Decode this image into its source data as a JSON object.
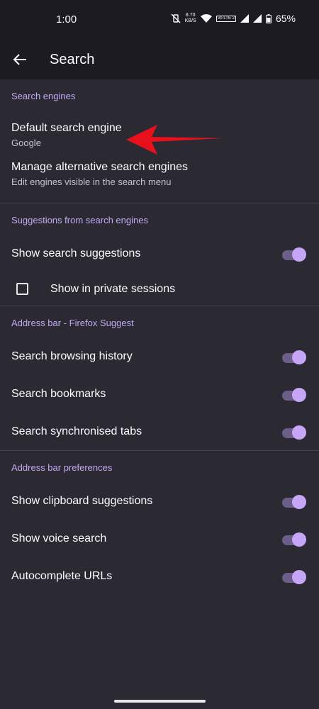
{
  "status_bar": {
    "time": "1:00",
    "net_speed_value": "8.70",
    "net_speed_unit": "KB/S",
    "volte_label": "Vo LTE 2",
    "battery_percent": "65%"
  },
  "app_bar": {
    "title": "Search"
  },
  "sections": {
    "search_engines": {
      "header": "Search engines",
      "default_engine": {
        "title": "Default search engine",
        "summary": "Google"
      },
      "manage_engines": {
        "title": "Manage alternative search engines",
        "summary": "Edit engines visible in the search menu"
      }
    },
    "suggestions": {
      "header": "Suggestions from search engines",
      "show_search_suggestions": {
        "label": "Show search suggestions",
        "enabled": true
      },
      "show_in_private": {
        "label": "Show in private sessions",
        "checked": false
      }
    },
    "firefox_suggest": {
      "header": "Address bar - Firefox Suggest",
      "browsing_history": {
        "label": "Search browsing history",
        "enabled": true
      },
      "bookmarks": {
        "label": "Search bookmarks",
        "enabled": true
      },
      "synced_tabs": {
        "label": "Search synchronised tabs",
        "enabled": true
      }
    },
    "preferences": {
      "header": "Address bar preferences",
      "clipboard": {
        "label": "Show clipboard suggestions",
        "enabled": true
      },
      "voice_search": {
        "label": "Show voice search",
        "enabled": true
      },
      "autocomplete": {
        "label": "Autocomplete URLs",
        "enabled": true
      }
    }
  },
  "colors": {
    "background": "#2b2a33",
    "app_bar": "#1c1b22",
    "accent": "#c0a9f5",
    "toggle_thumb": "#c7a6f7",
    "annotation_arrow": "#e8101a"
  },
  "icons": {
    "back": "arrow-left-icon",
    "annotation": "red-arrow-icon"
  }
}
